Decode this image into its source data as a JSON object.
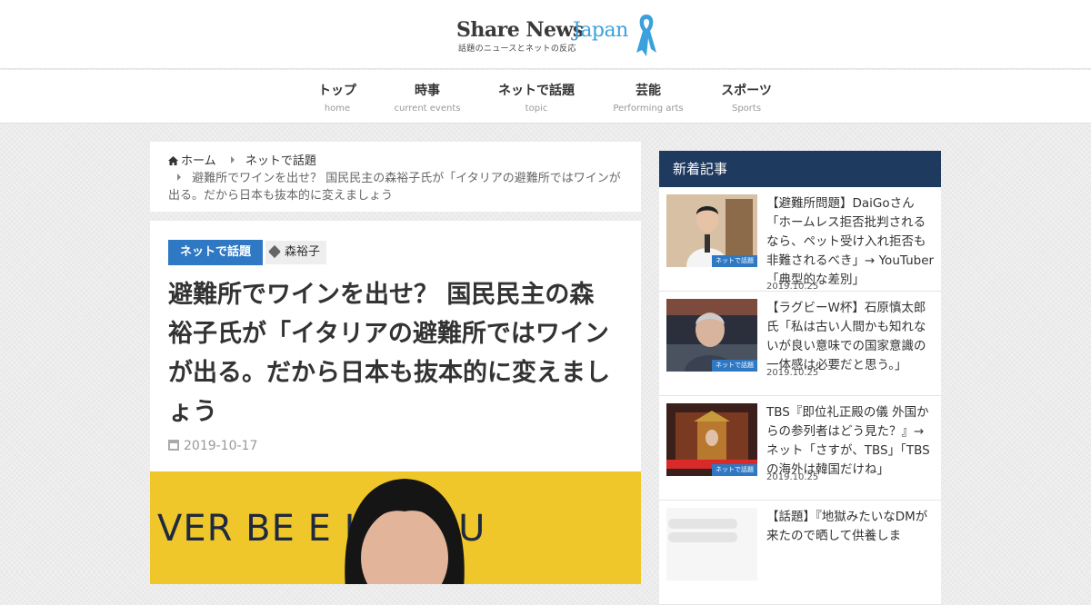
{
  "header": {
    "logo_share": "Share News",
    "logo_japan": "Japan",
    "logo_tagline": "話題のニュースとネットの反応"
  },
  "nav": [
    {
      "jp": "トップ",
      "en": "home"
    },
    {
      "jp": "時事",
      "en": "current events"
    },
    {
      "jp": "ネットで話題",
      "en": "topic"
    },
    {
      "jp": "芸能",
      "en": "Performing arts"
    },
    {
      "jp": "スポーツ",
      "en": "Sports"
    }
  ],
  "breadcrumb": {
    "home": "ホーム",
    "category": "ネットで話題",
    "current": "避難所でワインを出せ？ 国民民主の森裕子氏が「イタリアの避難所ではワインが出る。だから日本も抜本的に変えましょう"
  },
  "article": {
    "category": "ネットで話題",
    "tag": "森裕子",
    "title": "避難所でワインを出せ？ 国民民主の森裕子氏が「イタリアの避難所ではワインが出る。だから日本も抜本的に変えましょう",
    "date": "2019-10-17",
    "image_text": "VER BE E   L ABOU"
  },
  "sidebar": {
    "title": "新着記事",
    "items": [
      {
        "title": "【避難所問題】DaiGoさん「ホームレス拒否批判されるなら、ペット受け入れ拒否も非難されるべき」→ YouTuber「典型的な差別」",
        "date": "2019.10.25",
        "badge": "ネットで話題"
      },
      {
        "title": "【ラグビーW杯】石原慎太郎氏「私は古い人間かも知れないが良い意味での国家意識の一体感は必要だと思う。」",
        "date": "2019.10.25",
        "badge": "ネットで話題"
      },
      {
        "title": "TBS『即位礼正殿の儀 外国からの参列者はどう見た？』→ ネット「さすが、TBS」「TBSの海外は韓国だけね」",
        "date": "2019.10.25",
        "badge": "ネットで話題"
      },
      {
        "title": "【話題】『地獄みたいなDMが来たので晒して供養しま",
        "date": "",
        "badge": ""
      }
    ]
  },
  "colors": {
    "accent_blue": "#2f78c3",
    "sidebar_header": "#1f3a5f",
    "logo_japan": "#3aa1dc",
    "image_yellow": "#f0c72b"
  }
}
